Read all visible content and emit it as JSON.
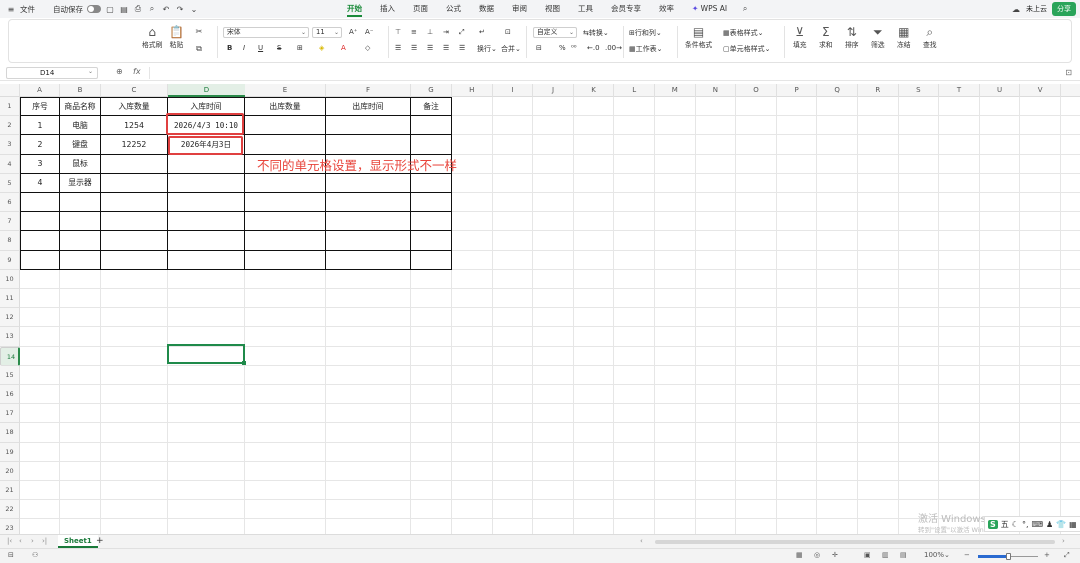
{
  "topbar": {
    "file": "文件",
    "autosave": "自动保存",
    "tabs": [
      "开始",
      "插入",
      "页面",
      "公式",
      "数据",
      "审阅",
      "视图",
      "工具",
      "会员专享",
      "效率",
      "WPS AI"
    ],
    "cloud": "未上云",
    "share": "分享"
  },
  "ribbon": {
    "format_painter": "格式刷",
    "paste": "粘贴",
    "font_name": "宋体",
    "font_size": "11",
    "custom": "自定义",
    "convert": "转换",
    "wrap": "换行",
    "merge": "合并",
    "row_col": "行和列",
    "worksheet": "工作表",
    "conditional": "条件格式",
    "table_style": "表格样式",
    "cell_style": "单元格样式",
    "fill": "填充",
    "sum": "求和",
    "sort": "排序",
    "filter": "筛选",
    "freeze": "冻结",
    "find": "查找"
  },
  "formula_bar": {
    "name_box": "D14",
    "fx": "fx",
    "value": ""
  },
  "columns": [
    "A",
    "B",
    "C",
    "D",
    "E",
    "F",
    "G",
    "H",
    "I",
    "J",
    "K",
    "L",
    "M",
    "N",
    "O",
    "P",
    "Q",
    "R",
    "S",
    "T",
    "U",
    "V"
  ],
  "rows": [
    "1",
    "2",
    "3",
    "4",
    "5",
    "6",
    "7",
    "8",
    "9",
    "10",
    "11",
    "12",
    "13",
    "14",
    "15",
    "16",
    "17",
    "18",
    "19",
    "20",
    "21",
    "22",
    "23"
  ],
  "table": {
    "headers": [
      "序号",
      "商品名称",
      "入库数量",
      "入库时间",
      "出库数量",
      "出库时间",
      "备注"
    ],
    "data": [
      [
        "1",
        "电脑",
        "1254",
        "2026/4/3 10:10",
        "",
        "",
        ""
      ],
      [
        "2",
        "键盘",
        "12252",
        "2026年4月3日",
        "",
        "",
        ""
      ],
      [
        "3",
        "鼠标",
        "",
        "",
        "",
        "",
        ""
      ],
      [
        "4",
        "显示器",
        "",
        "",
        "",
        "",
        ""
      ],
      [
        "",
        "",
        "",
        "",
        "",
        "",
        ""
      ],
      [
        "",
        "",
        "",
        "",
        "",
        "",
        ""
      ],
      [
        "",
        "",
        "",
        "",
        "",
        "",
        ""
      ],
      [
        "",
        "",
        "",
        "",
        "",
        "",
        ""
      ]
    ]
  },
  "annotation": "不同的单元格设置，显示形式不一样",
  "sheet_tab": "Sheet1",
  "zoom": "100%",
  "watermark": "激活 Windows",
  "watermark_sub": "转到\"设置\"以激活 Windows",
  "ime": "五",
  "colors": {
    "accent": "#1a8a3a",
    "annotation_red": "#e8453c"
  }
}
